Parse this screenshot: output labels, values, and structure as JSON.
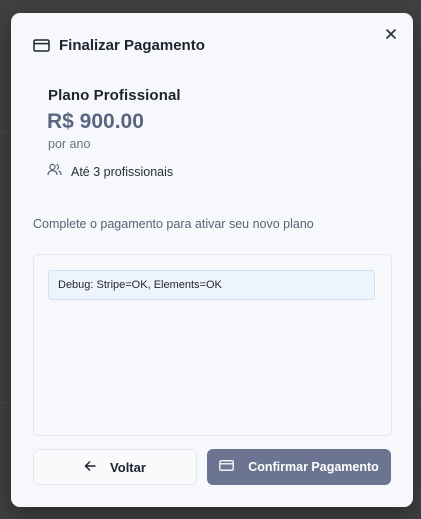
{
  "modal": {
    "title": "Finalizar Pagamento",
    "title_icon": "credit-card-icon",
    "close_icon": "close-icon"
  },
  "plan": {
    "name": "Plano Profissional",
    "price": "R$ 900.00",
    "period": "por ano",
    "users_icon": "users-icon",
    "users_label": "Até 3 profissionais"
  },
  "instruction": "Complete o pagamento para ativar seu novo plano",
  "payment": {
    "debug_text": "Debug: Stripe=OK, Elements=OK"
  },
  "actions": {
    "back_label": "Voltar",
    "back_icon": "arrow-left-icon",
    "confirm_label": "Confirmar Pagamento",
    "confirm_icon": "credit-card-icon"
  },
  "colors": {
    "modal_bg": "#f7f8fb",
    "price": "#5a6582",
    "confirm_bg": "#6b7591",
    "debug_border": "#cfe0f2"
  }
}
